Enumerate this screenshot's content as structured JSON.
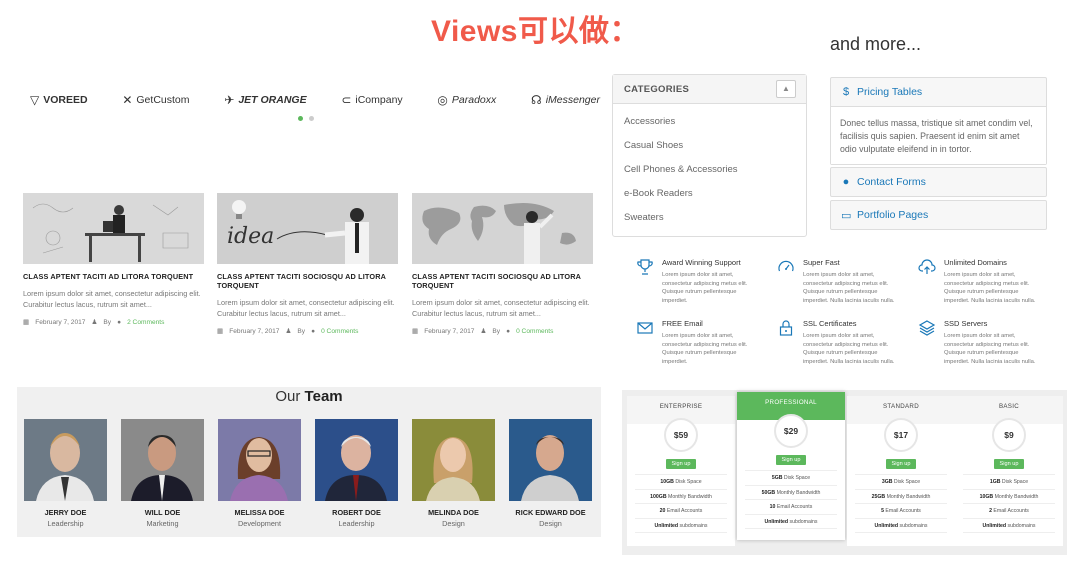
{
  "heading": "Views可以做：",
  "more_label": "and more...",
  "brand_logos": [
    {
      "name": "VOREED",
      "icon": "v-logo-icon"
    },
    {
      "name": "GetCustom",
      "icon": "x-logo-icon"
    },
    {
      "name": "JET ORANGE",
      "icon": "jet-logo-icon"
    },
    {
      "name": "iCompany",
      "icon": "c-logo-icon"
    },
    {
      "name": "Paradoxx",
      "icon": "circle-logo-icon"
    },
    {
      "name": "iMessenger",
      "icon": "chat-logo-icon"
    }
  ],
  "carousel": {
    "pages": 2,
    "active": 1
  },
  "categories": {
    "title": "CATEGORIES",
    "toggle_icon": "chevron-up-icon",
    "items": [
      "Accessories",
      "Casual Shoes",
      "Cell Phones & Accessories",
      "e-Book Readers",
      "Sweaters"
    ]
  },
  "accordion": [
    {
      "label": "Pricing Tables",
      "icon": "dollar-icon",
      "expanded": true,
      "body": "Donec tellus massa, tristique sit amet condim vel, facilisis quis sapien. Praesent id enim sit amet odio vulputate eleifend in in tortor."
    },
    {
      "label": "Contact Forms",
      "icon": "comment-icon",
      "expanded": false
    },
    {
      "label": "Portfolio Pages",
      "icon": "monitor-icon",
      "expanded": false
    }
  ],
  "posts": [
    {
      "title": "CLASS APTENT TACITI AD LITORA TORQUENT",
      "excerpt": "Lorem ipsum dolor sit amet, consectetur adipiscing elit. Curabitur lectus lacus, rutrum sit amet...",
      "date": "February 7, 2017",
      "by": "By",
      "comments": "2 Comments"
    },
    {
      "title": "CLASS APTENT TACITI SOCIOSQU AD LITORA TORQUENT",
      "excerpt": "Lorem ipsum dolor sit amet, consectetur adipiscing elit. Curabitur lectus lacus, rutrum sit amet...",
      "date": "February 7, 2017",
      "by": "By",
      "comments": "0 Comments"
    },
    {
      "title": "CLASS APTENT TACITI SOCIOSQU AD LITORA TORQUENT",
      "excerpt": "Lorem ipsum dolor sit amet, consectetur adipiscing elit. Curabitur lectus lacus, rutrum sit amet...",
      "date": "February 7, 2017",
      "by": "By",
      "comments": "0 Comments"
    }
  ],
  "team": {
    "title_prefix": "Our",
    "title_bold": "Team",
    "members": [
      {
        "name": "JERRY DOE",
        "role": "Leadership"
      },
      {
        "name": "WILL DOE",
        "role": "Marketing"
      },
      {
        "name": "MELISSA DOE",
        "role": "Development"
      },
      {
        "name": "ROBERT DOE",
        "role": "Leadership"
      },
      {
        "name": "MELINDA DOE",
        "role": "Design"
      },
      {
        "name": "RICK EDWARD DOE",
        "role": "Design"
      }
    ]
  },
  "features": [
    {
      "title": "Award Winning Support",
      "icon": "trophy-icon",
      "desc": "Lorem ipsum dolor sit amet, consectetur adipiscing metus elit. Quisque rutrum pellentesque imperdiet."
    },
    {
      "title": "Super Fast",
      "icon": "speedometer-icon",
      "desc": "Lorem ipsum dolor sit amet, consectetur adipiscing metus elit. Quisque rutrum pellentesque imperdiet. Nulla lacinia iaculis nulla."
    },
    {
      "title": "Unlimited Domains",
      "icon": "cloud-upload-icon",
      "desc": "Lorem ipsum dolor sit amet, consectetur adipiscing metus elit. Quisque rutrum pellentesque imperdiet. Nulla lacinia iaculis nulla."
    },
    {
      "title": "FREE Email",
      "icon": "envelope-icon",
      "desc": "Lorem ipsum dolor sit amet, consectetur adipiscing metus elit. Quisque rutrum pellentesque imperdiet."
    },
    {
      "title": "SSL Certificates",
      "icon": "lock-icon",
      "desc": "Lorem ipsum dolor sit amet, consectetur adipiscing metus elit. Quisque rutrum pellentesque imperdiet. Nulla lacinia iaculis nulla."
    },
    {
      "title": "SSD Servers",
      "icon": "layers-icon",
      "desc": "Lorem ipsum dolor sit amet, consectetur adipiscing metus elit. Quisque rutrum pellentesque imperdiet. Nulla lacinia iaculis nulla."
    }
  ],
  "pricing": [
    {
      "name": "ENTERPRISE",
      "price": "$59",
      "button": "Sign up",
      "highlight": false,
      "features": [
        {
          "b": "10GB",
          "t": " Disk Space"
        },
        {
          "b": "100GB",
          "t": " Monthly Bandwidth"
        },
        {
          "b": "20",
          "t": " Email Accounts"
        },
        {
          "b": "Unlimited",
          "t": " subdomains"
        }
      ]
    },
    {
      "name": "PROFESSIONAL",
      "price": "$29",
      "button": "Sign up",
      "highlight": true,
      "features": [
        {
          "b": "5GB",
          "t": " Disk Space"
        },
        {
          "b": "50GB",
          "t": " Monthly Bandwidth"
        },
        {
          "b": "10",
          "t": " Email Accounts"
        },
        {
          "b": "Unlimited",
          "t": " subdomains"
        }
      ]
    },
    {
      "name": "STANDARD",
      "price": "$17",
      "button": "Sign up",
      "highlight": false,
      "features": [
        {
          "b": "3GB",
          "t": " Disk Space"
        },
        {
          "b": "25GB",
          "t": " Monthly Bandwidth"
        },
        {
          "b": "5",
          "t": " Email Accounts"
        },
        {
          "b": "Unlimited",
          "t": " subdomains"
        }
      ]
    },
    {
      "name": "BASIC",
      "price": "$9",
      "button": "Sign up",
      "highlight": false,
      "features": [
        {
          "b": "1GB",
          "t": " Disk Space"
        },
        {
          "b": "10GB",
          "t": " Monthly Bandwidth"
        },
        {
          "b": "2",
          "t": " Email Accounts"
        },
        {
          "b": "Unlimited",
          "t": " subdomains"
        }
      ]
    }
  ],
  "colors": {
    "accent_green": "#5cb85c",
    "link_blue": "#1a78b8",
    "heading_red": "#f05a4a"
  }
}
